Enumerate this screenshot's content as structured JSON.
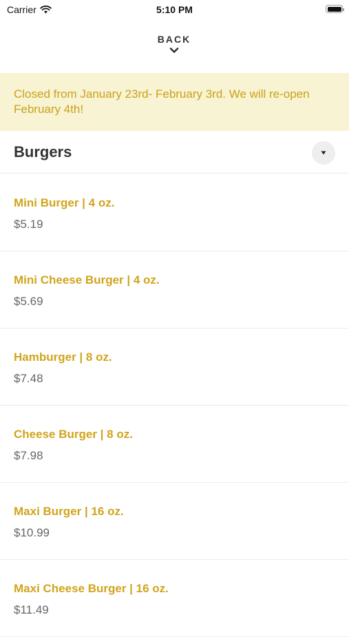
{
  "status_bar": {
    "carrier": "Carrier",
    "time": "5:10 PM"
  },
  "header": {
    "back_label": "BACK"
  },
  "notice": {
    "text": "Closed from January 23rd- February 3rd. We will re-open February 4th!"
  },
  "section": {
    "title": "Burgers"
  },
  "menu_items": [
    {
      "name": "Mini Burger | 4 oz.",
      "price": "$5.19"
    },
    {
      "name": "Mini Cheese Burger | 4 oz.",
      "price": "$5.69"
    },
    {
      "name": "Hamburger | 8 oz.",
      "price": "$7.48"
    },
    {
      "name": "Cheese Burger | 8 oz.",
      "price": "$7.98"
    },
    {
      "name": "Maxi Burger | 16 oz.",
      "price": "$10.99"
    },
    {
      "name": "Maxi Cheese Burger | 16 oz.",
      "price": "$11.49"
    }
  ],
  "colors": {
    "accent": "#d1a41b",
    "notice_background": "#f8f3d2",
    "notice_text": "#c9a21a",
    "price_text": "#666666"
  },
  "icons": {
    "wifi": "wifi-icon",
    "battery": "battery-icon",
    "back": "chevron-down-icon",
    "collapse": "caret-down-icon"
  }
}
